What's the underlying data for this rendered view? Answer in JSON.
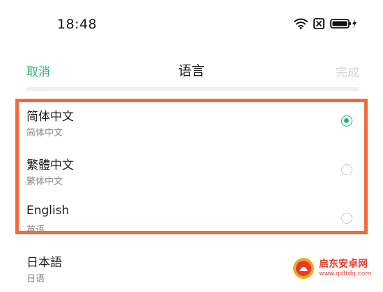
{
  "status_bar": {
    "time": "18:48",
    "icons": [
      "wifi-icon",
      "no-sim-icon",
      "battery-charging-icon"
    ]
  },
  "nav_bar": {
    "cancel_label": "取消",
    "title": "语言",
    "done_label": "完成"
  },
  "languages": [
    {
      "name": "简体中文",
      "native": "简体中文",
      "selected": true
    },
    {
      "name": "繁體中文",
      "native": "繁体中文",
      "selected": false
    },
    {
      "name": "English",
      "native": "英语",
      "selected": false
    },
    {
      "name": "日本語",
      "native": "日语",
      "selected": false
    }
  ],
  "colors": {
    "accent": "#27b373",
    "highlight": "#f26a3b",
    "disabled": "#d4d4d4"
  },
  "watermark": {
    "title": "启东安卓网",
    "url": "www.qdltdq.com"
  }
}
